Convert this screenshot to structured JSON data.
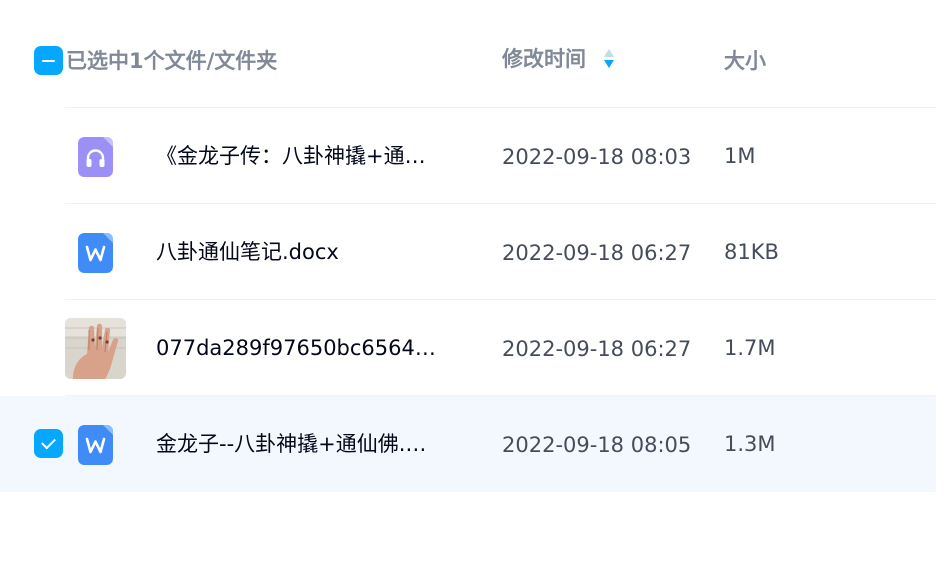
{
  "header": {
    "selection_text": "已选中1个文件/文件夹",
    "modified_label": "修改时间",
    "size_label": "大小",
    "sort_direction": "descending"
  },
  "colors": {
    "accent": "#06a7ff",
    "header_text": "#818999",
    "name_text": "#03081a",
    "meta_text": "#454d5a",
    "selected_row_bg": "#f2f8fe",
    "audio_icon": "#9c8ff6",
    "word_icon": "#3f8cf7"
  },
  "files": [
    {
      "name": "《金龙子传：八卦神撬+通…",
      "modified": "2022-09-18 08:03",
      "size": "1M",
      "icon": "headphones-icon",
      "selected": false
    },
    {
      "name": "八卦通仙笔记.docx",
      "modified": "2022-09-18 06:27",
      "size": "81KB",
      "icon": "word-document-icon",
      "selected": false
    },
    {
      "name": "077da289f97650bc6564…",
      "modified": "2022-09-18 06:27",
      "size": "1.7M",
      "icon": "image-thumbnail",
      "selected": false
    },
    {
      "name": "金龙子--八卦神撬+通仙佛.…",
      "modified": "2022-09-18 08:05",
      "size": "1.3M",
      "icon": "word-document-icon",
      "selected": true
    }
  ]
}
